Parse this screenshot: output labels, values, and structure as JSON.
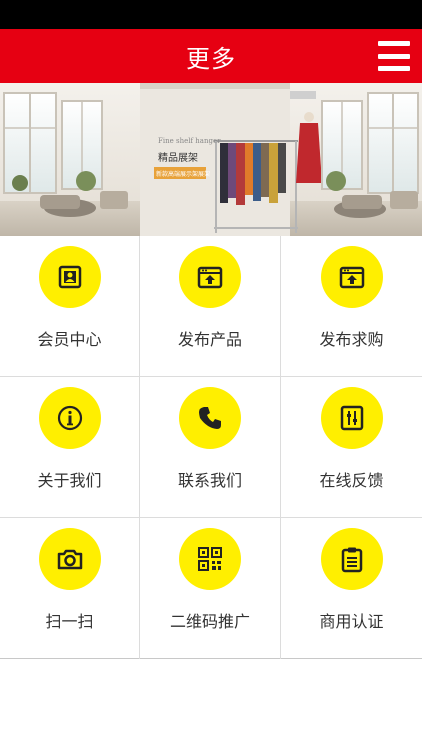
{
  "header": {
    "title": "更多",
    "menu_icon": "menu-icon"
  },
  "banner": {
    "headline": "精品展架",
    "tagline_script": "Fine shelf hanger",
    "badge": "新款高端展示架展架"
  },
  "colors": {
    "header_bg": "#e60012",
    "icon_bg": "#ffef00",
    "status_bar": "#000000"
  },
  "grid": {
    "items": [
      {
        "label": "会员中心",
        "icon": "member-card-icon"
      },
      {
        "label": "发布产品",
        "icon": "publish-product-icon"
      },
      {
        "label": "发布求购",
        "icon": "publish-request-icon"
      },
      {
        "label": "关于我们",
        "icon": "info-icon"
      },
      {
        "label": "联系我们",
        "icon": "phone-icon"
      },
      {
        "label": "在线反馈",
        "icon": "feedback-icon"
      },
      {
        "label": "扫一扫",
        "icon": "camera-icon"
      },
      {
        "label": "二维码推广",
        "icon": "qr-code-icon"
      },
      {
        "label": "商用认证",
        "icon": "clipboard-icon"
      }
    ]
  }
}
